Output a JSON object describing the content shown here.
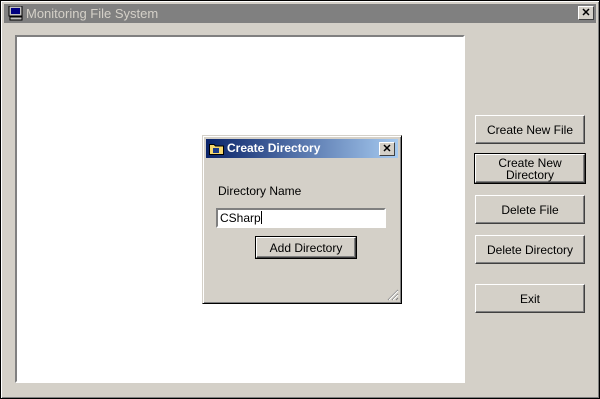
{
  "window": {
    "title": "Monitoring File System",
    "close_glyph": "✕"
  },
  "sidebar": {
    "create_file": "Create New File",
    "create_dir_line1": "Create New",
    "create_dir_line2": "Directory",
    "delete_file": "Delete File",
    "delete_dir": "Delete Directory",
    "exit": "Exit"
  },
  "dialog": {
    "title": "Create Directory",
    "close_glyph": "✕",
    "label": "Directory Name",
    "input_value": "CSharp",
    "button": "Add Directory"
  },
  "icons": {
    "app": "computer-icon",
    "dialog": "folder-icon",
    "resize": "resize-grip-icon"
  }
}
